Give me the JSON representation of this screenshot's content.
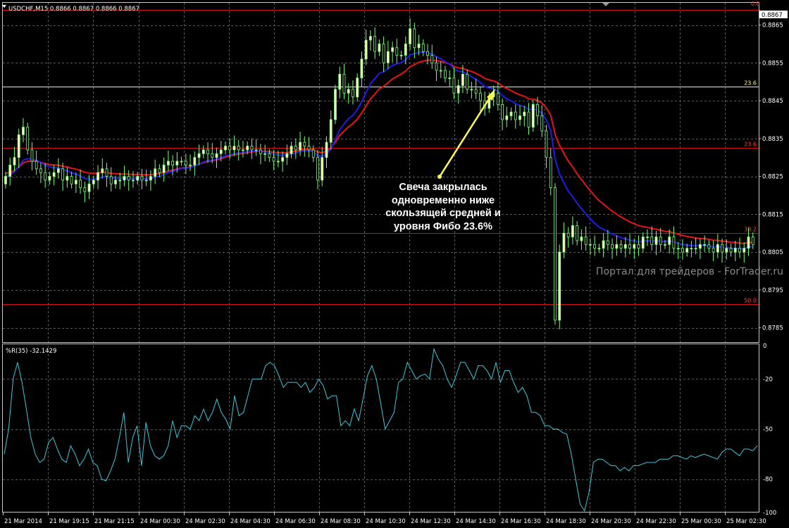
{
  "window": {
    "symbol_info": "USDCHF,M15  0.8866 0.8867 0.8866 0.8867",
    "price_tag": "0.8867",
    "fib_top_label": "0.0"
  },
  "watermark": "Портал для трейдеров - ForTrader.ru",
  "annotation": {
    "lines": [
      "Свеча закрылась",
      "одновременно ниже",
      "скользящей средней и",
      "уровня Фибо 23.6%"
    ]
  },
  "indicator": {
    "label": "%R(35) -32.1429",
    "axis_labels": [
      "0",
      "-20",
      "-50",
      "-80",
      "-100"
    ]
  },
  "colors": {
    "background": "#000000",
    "grid": "#5a5a5a",
    "bull_candle": "#ffffbe",
    "bear_candle": "#000000",
    "candle_wick": "#7cfc7c",
    "ma_fast": "#1e1ee6",
    "ma_slow": "#e61414",
    "fib_line": "#d01010",
    "fib_yellow": "#f0f08c",
    "wpr_line": "#3cc8dc",
    "arrow": "#ffff50"
  },
  "chart_data": [
    {
      "type": "candlestick",
      "symbol": "USDCHF",
      "timeframe": "M15",
      "y_tick_labels": [
        "0.8865",
        "0.8855",
        "0.8845",
        "0.8835",
        "0.8825",
        "0.8815",
        "0.8805",
        "0.8795",
        "0.8785"
      ],
      "ylim": [
        0.87812,
        0.8869
      ],
      "x_tick_labels": [
        "21 Mar 2014",
        "21 Mar 19:15",
        "21 Mar 21:15",
        "24 Mar 00:30",
        "24 Mar 02:30",
        "24 Mar 04:30",
        "24 Mar 06:30",
        "24 Mar 08:30",
        "24 Mar 10:30",
        "24 Mar 12:30",
        "24 Mar 14:30",
        "24 Mar 16:30",
        "24 Mar 18:30",
        "24 Mar 20:30",
        "24 Mar 22:30",
        "25 Mar 00:30",
        "25 Mar 02:30"
      ],
      "fib_levels": [
        {
          "label": "0.0",
          "price": 0.8869
        },
        {
          "label": "23.6",
          "price": 0.88488
        },
        {
          "label": "23.6",
          "price": 0.88325
        },
        {
          "label": "38.2",
          "price": 0.881
        },
        {
          "label": "50.0",
          "price": 0.87912
        }
      ],
      "close": [
        0.8825,
        0.8828,
        0.883,
        0.8836,
        0.8838,
        0.8832,
        0.8829,
        0.8827,
        0.8826,
        0.8824,
        0.8825,
        0.8826,
        0.8827,
        0.8824,
        0.8825,
        0.8823,
        0.8824,
        0.8822,
        0.8821,
        0.8823,
        0.8824,
        0.8826,
        0.8827,
        0.8825,
        0.8823,
        0.8824,
        0.8824,
        0.8825,
        0.8824,
        0.8824,
        0.8825,
        0.8824,
        0.8824,
        0.8825,
        0.8827,
        0.8826,
        0.8828,
        0.8829,
        0.8828,
        0.8829,
        0.8829,
        0.8828,
        0.8828,
        0.883,
        0.8831,
        0.8832,
        0.8831,
        0.883,
        0.8831,
        0.8832,
        0.8833,
        0.8832,
        0.8833,
        0.8832,
        0.8832,
        0.8833,
        0.8832,
        0.8832,
        0.8831,
        0.8831,
        0.883,
        0.8829,
        0.8829,
        0.883,
        0.8831,
        0.8833,
        0.8832,
        0.8834,
        0.8833,
        0.8832,
        0.883,
        0.8824,
        0.883,
        0.8834,
        0.884,
        0.8848,
        0.8852,
        0.8847,
        0.8848,
        0.8846,
        0.8851,
        0.8856,
        0.8861,
        0.8862,
        0.8858,
        0.886,
        0.8855,
        0.8858,
        0.8859,
        0.8857,
        0.8857,
        0.886,
        0.8864,
        0.8859,
        0.886,
        0.8858,
        0.8857,
        0.8855,
        0.8853,
        0.8853,
        0.8851,
        0.8851,
        0.8847,
        0.8849,
        0.8852,
        0.8848,
        0.8848,
        0.8847,
        0.8845,
        0.8843,
        0.8846,
        0.8847,
        0.8844,
        0.884,
        0.8841,
        0.8842,
        0.884,
        0.8841,
        0.8842,
        0.8838,
        0.8844,
        0.8841,
        0.8837,
        0.883,
        0.8822,
        0.8787,
        0.8805,
        0.881,
        0.8809,
        0.8812,
        0.8808,
        0.8809,
        0.8807,
        0.8807,
        0.8806,
        0.8806,
        0.8808,
        0.8807,
        0.8806,
        0.8807,
        0.8806,
        0.8807,
        0.8806,
        0.8807,
        0.8806,
        0.8809,
        0.8809,
        0.8807,
        0.8809,
        0.8807,
        0.8807,
        0.8809,
        0.8806,
        0.8806,
        0.8805,
        0.8806,
        0.8806,
        0.8806,
        0.8807,
        0.8807,
        0.8806,
        0.8805,
        0.8807,
        0.8805,
        0.8806,
        0.8805,
        0.8806,
        0.8805,
        0.8806,
        0.8809,
        0.8807
      ]
    },
    {
      "type": "line",
      "name": "%R(35)",
      "ylim": [
        -100,
        0
      ],
      "y_tick_labels": [
        "0",
        "-20",
        "-50",
        "-80",
        "-100"
      ],
      "values": [
        -65,
        -50,
        -20,
        -10,
        -22,
        -38,
        -55,
        -65,
        -70,
        -68,
        -58,
        -55,
        -62,
        -68,
        -70,
        -60,
        -65,
        -72,
        -68,
        -62,
        -70,
        -72,
        -80,
        -81,
        -75,
        -68,
        -55,
        -40,
        -70,
        -55,
        -48,
        -72,
        -46,
        -60,
        -66,
        -68,
        -66,
        -60,
        -45,
        -55,
        -48,
        -48,
        -50,
        -42,
        -45,
        -38,
        -45,
        -40,
        -32,
        -40,
        -44,
        -50,
        -30,
        -42,
        -40,
        -30,
        -20,
        -20,
        -20,
        -12,
        -10,
        -12,
        -18,
        -25,
        -22,
        -22,
        -22,
        -25,
        -22,
        -28,
        -25,
        -20,
        -24,
        -32,
        -30,
        -30,
        -48,
        -45,
        -48,
        -38,
        -45,
        -32,
        -18,
        -12,
        -20,
        -35,
        -50,
        -45,
        -40,
        -22,
        -20,
        -10,
        -15,
        -20,
        -18,
        -17,
        -20,
        -2,
        -8,
        -12,
        -20,
        -25,
        -18,
        -10,
        -10,
        -15,
        -20,
        -12,
        -12,
        -15,
        -20,
        -10,
        -22,
        -15,
        -15,
        -22,
        -28,
        -25,
        -30,
        -40,
        -40,
        -42,
        -48,
        -48,
        -50,
        -50,
        -52,
        -53,
        -65,
        -80,
        -95,
        -99,
        -88,
        -70,
        -68,
        -68,
        -70,
        -72,
        -72,
        -75,
        -73,
        -75,
        -72,
        -72,
        -71,
        -70,
        -70,
        -70,
        -68,
        -68,
        -68,
        -66,
        -66,
        -67,
        -68,
        -66,
        -67,
        -66,
        -65,
        -66,
        -67,
        -68,
        -64,
        -62,
        -62,
        -64,
        -66,
        -62,
        -62,
        -63,
        -60
      ]
    }
  ]
}
